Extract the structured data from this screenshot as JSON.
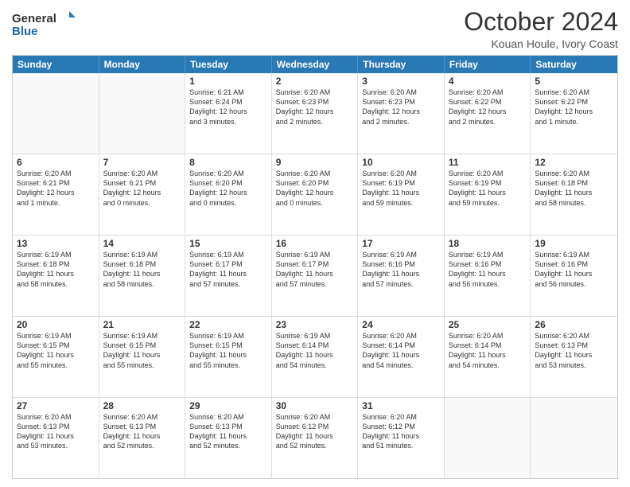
{
  "logo": {
    "text_general": "General",
    "text_blue": "Blue"
  },
  "title": "October 2024",
  "location": "Kouan Houle, Ivory Coast",
  "header_days": [
    "Sunday",
    "Monday",
    "Tuesday",
    "Wednesday",
    "Thursday",
    "Friday",
    "Saturday"
  ],
  "rows": [
    [
      {
        "day": "",
        "empty": true,
        "text": ""
      },
      {
        "day": "",
        "empty": true,
        "text": ""
      },
      {
        "day": "1",
        "text": "Sunrise: 6:21 AM\nSunset: 6:24 PM\nDaylight: 12 hours\nand 3 minutes."
      },
      {
        "day": "2",
        "text": "Sunrise: 6:20 AM\nSunset: 6:23 PM\nDaylight: 12 hours\nand 2 minutes."
      },
      {
        "day": "3",
        "text": "Sunrise: 6:20 AM\nSunset: 6:23 PM\nDaylight: 12 hours\nand 2 minutes."
      },
      {
        "day": "4",
        "text": "Sunrise: 6:20 AM\nSunset: 6:22 PM\nDaylight: 12 hours\nand 2 minutes."
      },
      {
        "day": "5",
        "text": "Sunrise: 6:20 AM\nSunset: 6:22 PM\nDaylight: 12 hours\nand 1 minute."
      }
    ],
    [
      {
        "day": "6",
        "text": "Sunrise: 6:20 AM\nSunset: 6:21 PM\nDaylight: 12 hours\nand 1 minute."
      },
      {
        "day": "7",
        "text": "Sunrise: 6:20 AM\nSunset: 6:21 PM\nDaylight: 12 hours\nand 0 minutes."
      },
      {
        "day": "8",
        "text": "Sunrise: 6:20 AM\nSunset: 6:20 PM\nDaylight: 12 hours\nand 0 minutes."
      },
      {
        "day": "9",
        "text": "Sunrise: 6:20 AM\nSunset: 6:20 PM\nDaylight: 12 hours\nand 0 minutes."
      },
      {
        "day": "10",
        "text": "Sunrise: 6:20 AM\nSunset: 6:19 PM\nDaylight: 11 hours\nand 59 minutes."
      },
      {
        "day": "11",
        "text": "Sunrise: 6:20 AM\nSunset: 6:19 PM\nDaylight: 11 hours\nand 59 minutes."
      },
      {
        "day": "12",
        "text": "Sunrise: 6:20 AM\nSunset: 6:18 PM\nDaylight: 11 hours\nand 58 minutes."
      }
    ],
    [
      {
        "day": "13",
        "text": "Sunrise: 6:19 AM\nSunset: 6:18 PM\nDaylight: 11 hours\nand 58 minutes."
      },
      {
        "day": "14",
        "text": "Sunrise: 6:19 AM\nSunset: 6:18 PM\nDaylight: 11 hours\nand 58 minutes."
      },
      {
        "day": "15",
        "text": "Sunrise: 6:19 AM\nSunset: 6:17 PM\nDaylight: 11 hours\nand 57 minutes."
      },
      {
        "day": "16",
        "text": "Sunrise: 6:19 AM\nSunset: 6:17 PM\nDaylight: 11 hours\nand 57 minutes."
      },
      {
        "day": "17",
        "text": "Sunrise: 6:19 AM\nSunset: 6:16 PM\nDaylight: 11 hours\nand 57 minutes."
      },
      {
        "day": "18",
        "text": "Sunrise: 6:19 AM\nSunset: 6:16 PM\nDaylight: 11 hours\nand 56 minutes."
      },
      {
        "day": "19",
        "text": "Sunrise: 6:19 AM\nSunset: 6:16 PM\nDaylight: 11 hours\nand 56 minutes."
      }
    ],
    [
      {
        "day": "20",
        "text": "Sunrise: 6:19 AM\nSunset: 6:15 PM\nDaylight: 11 hours\nand 55 minutes."
      },
      {
        "day": "21",
        "text": "Sunrise: 6:19 AM\nSunset: 6:15 PM\nDaylight: 11 hours\nand 55 minutes."
      },
      {
        "day": "22",
        "text": "Sunrise: 6:19 AM\nSunset: 6:15 PM\nDaylight: 11 hours\nand 55 minutes."
      },
      {
        "day": "23",
        "text": "Sunrise: 6:19 AM\nSunset: 6:14 PM\nDaylight: 11 hours\nand 54 minutes."
      },
      {
        "day": "24",
        "text": "Sunrise: 6:20 AM\nSunset: 6:14 PM\nDaylight: 11 hours\nand 54 minutes."
      },
      {
        "day": "25",
        "text": "Sunrise: 6:20 AM\nSunset: 6:14 PM\nDaylight: 11 hours\nand 54 minutes."
      },
      {
        "day": "26",
        "text": "Sunrise: 6:20 AM\nSunset: 6:13 PM\nDaylight: 11 hours\nand 53 minutes."
      }
    ],
    [
      {
        "day": "27",
        "text": "Sunrise: 6:20 AM\nSunset: 6:13 PM\nDaylight: 11 hours\nand 53 minutes."
      },
      {
        "day": "28",
        "text": "Sunrise: 6:20 AM\nSunset: 6:13 PM\nDaylight: 11 hours\nand 52 minutes."
      },
      {
        "day": "29",
        "text": "Sunrise: 6:20 AM\nSunset: 6:13 PM\nDaylight: 11 hours\nand 52 minutes."
      },
      {
        "day": "30",
        "text": "Sunrise: 6:20 AM\nSunset: 6:12 PM\nDaylight: 11 hours\nand 52 minutes."
      },
      {
        "day": "31",
        "text": "Sunrise: 6:20 AM\nSunset: 6:12 PM\nDaylight: 11 hours\nand 51 minutes."
      },
      {
        "day": "",
        "empty": true,
        "text": ""
      },
      {
        "day": "",
        "empty": true,
        "text": ""
      }
    ]
  ]
}
